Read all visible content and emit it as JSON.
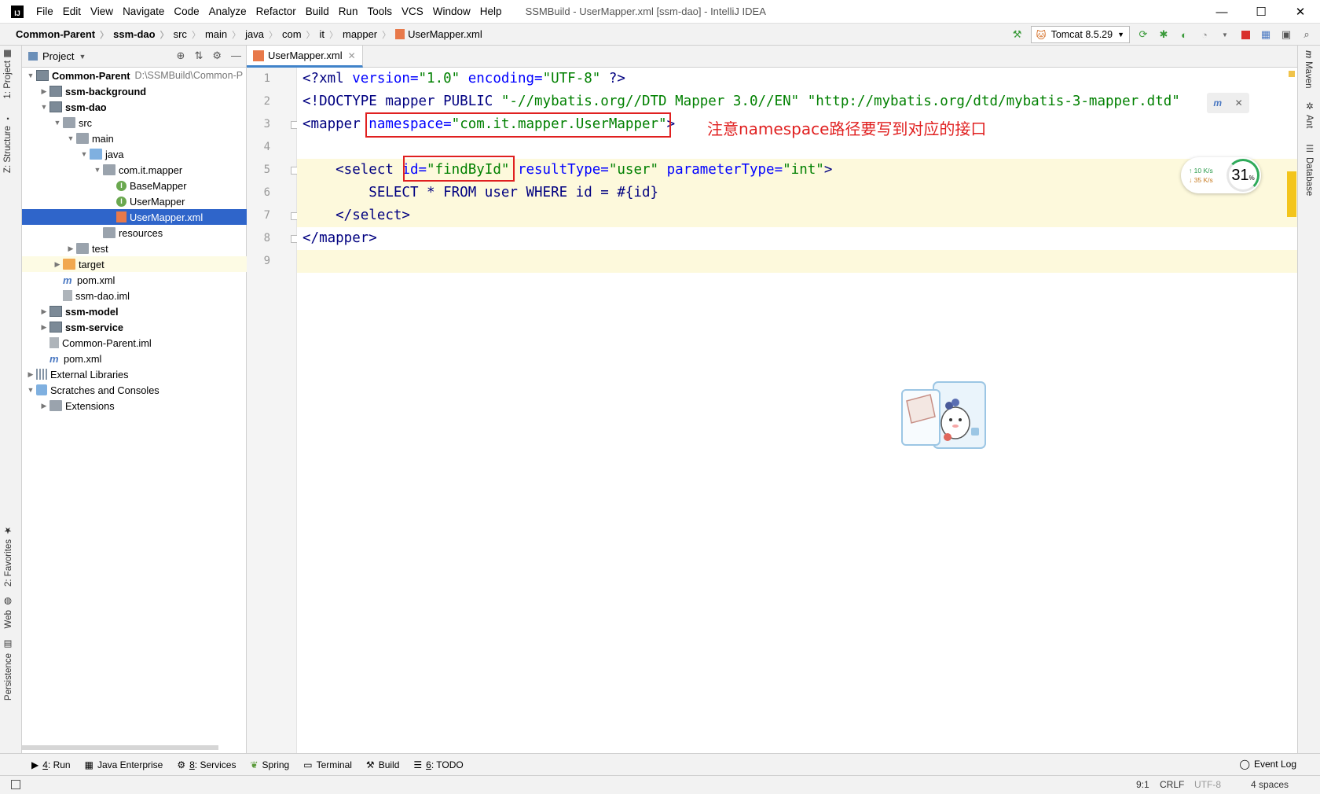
{
  "window": {
    "title": "SSMBuild - UserMapper.xml [ssm-dao] - IntelliJ IDEA",
    "menu": [
      "File",
      "Edit",
      "View",
      "Navigate",
      "Code",
      "Analyze",
      "Refactor",
      "Build",
      "Run",
      "Tools",
      "VCS",
      "Window",
      "Help"
    ],
    "controls": {
      "minimize": "—",
      "maximize": "☐",
      "close": "✕"
    }
  },
  "breadcrumbs": [
    "Common-Parent",
    "ssm-dao",
    "src",
    "main",
    "java",
    "com",
    "it",
    "mapper",
    "UserMapper.xml"
  ],
  "toolbar": {
    "run_config": "Tomcat 8.5.29"
  },
  "left_tool_tabs": [
    "1: Project",
    "Z: Structure",
    "2: Favorites",
    "Web",
    "Persistence"
  ],
  "right_tool_tabs": [
    "Maven",
    "Ant",
    "Database"
  ],
  "project_panel": {
    "title": "Project",
    "tree": [
      {
        "label": "Common-Parent",
        "path": "D:\\SSMBuild\\Common-P",
        "bold": true,
        "depth": 0,
        "arrow": "▼",
        "icon": "module"
      },
      {
        "label": "ssm-background",
        "bold": true,
        "depth": 1,
        "arrow": "▶",
        "icon": "module"
      },
      {
        "label": "ssm-dao",
        "bold": true,
        "depth": 1,
        "arrow": "▼",
        "icon": "module"
      },
      {
        "label": "src",
        "depth": 2,
        "arrow": "▼",
        "icon": "folder"
      },
      {
        "label": "main",
        "depth": 3,
        "arrow": "▼",
        "icon": "folder"
      },
      {
        "label": "java",
        "depth": 4,
        "arrow": "▼",
        "icon": "folder-blue"
      },
      {
        "label": "com.it.mapper",
        "depth": 5,
        "arrow": "▼",
        "icon": "folder"
      },
      {
        "label": "BaseMapper",
        "depth": 6,
        "arrow": "",
        "icon": "interface"
      },
      {
        "label": "UserMapper",
        "depth": 6,
        "arrow": "",
        "icon": "interface"
      },
      {
        "label": "UserMapper.xml",
        "depth": 6,
        "arrow": "",
        "icon": "xml",
        "selected": true
      },
      {
        "label": "resources",
        "depth": 5,
        "arrow": "",
        "icon": "folder"
      },
      {
        "label": "test",
        "depth": 3,
        "arrow": "▶",
        "icon": "folder"
      },
      {
        "label": "target",
        "depth": 2,
        "arrow": "▶",
        "icon": "folder-orange",
        "highlight": true
      },
      {
        "label": "pom.xml",
        "depth": 2,
        "arrow": "",
        "icon": "maven"
      },
      {
        "label": "ssm-dao.iml",
        "depth": 2,
        "arrow": "",
        "icon": "iml"
      },
      {
        "label": "ssm-model",
        "bold": true,
        "depth": 1,
        "arrow": "▶",
        "icon": "module"
      },
      {
        "label": "ssm-service",
        "bold": true,
        "depth": 1,
        "arrow": "▶",
        "icon": "module"
      },
      {
        "label": "Common-Parent.iml",
        "depth": 1,
        "arrow": "",
        "icon": "iml"
      },
      {
        "label": "pom.xml",
        "depth": 1,
        "arrow": "",
        "icon": "maven"
      },
      {
        "label": "External Libraries",
        "depth": 0,
        "arrow": "▶",
        "icon": "library"
      },
      {
        "label": "Scratches and Consoles",
        "depth": 0,
        "arrow": "▼",
        "icon": "scratch"
      },
      {
        "label": "Extensions",
        "depth": 1,
        "arrow": "▶",
        "icon": "folder"
      }
    ]
  },
  "editor": {
    "tab": "UserMapper.xml",
    "line_numbers": [
      "1",
      "2",
      "3",
      "4",
      "5",
      "6",
      "7",
      "8",
      "9"
    ],
    "lines": [
      {
        "t1": "<?xml ",
        "a1": "version=",
        "v1": "\"1.0\" ",
        "a2": "encoding=",
        "v2": "\"UTF-8\"",
        "t2": " ?>"
      },
      {
        "t1": "<!DOCTYPE mapper PUBLIC ",
        "v1": "\"-//mybatis.org//DTD Mapper 3.0//EN\" ",
        "v2": "\"http://mybatis.org/dtd/mybatis-3-mapper.dtd\""
      },
      {
        "t1": "<mapper ",
        "a1": "namespace=",
        "v1": "\"com.it.mapper.UserMapper\"",
        "t2": ">"
      },
      {},
      {
        "t1": "    <select ",
        "a1": "id=",
        "v1": "\"findById\" ",
        "a2": "resultType=",
        "v2": "\"user\" ",
        "a3": "parameterType=",
        "v3": "\"int\"",
        "t2": ">"
      },
      {
        "k": "        SELECT * FROM user WHERE id = #{id}"
      },
      {
        "t1": "    </select>"
      },
      {
        "t1": "</mapper>"
      },
      {}
    ],
    "annotation": "注意namespace路径要写到对应的接口",
    "maven_hint_close": "✕"
  },
  "network_widget": {
    "up": "10 K/s",
    "down": "35 K/s",
    "percent": "31",
    "unit": "%"
  },
  "bottom_tools": [
    {
      "key": "4",
      "label": ": Run"
    },
    {
      "key": "",
      "label": "Java Enterprise"
    },
    {
      "key": "8",
      "label": ": Services"
    },
    {
      "key": "",
      "label": "Spring"
    },
    {
      "key": "",
      "label": "Terminal"
    },
    {
      "key": "",
      "label": "Build"
    },
    {
      "key": "6",
      "label": ": TODO"
    }
  ],
  "event_log": "Event Log",
  "status": {
    "position": "9:1",
    "line_sep": "CRLF",
    "encoding": "UTF-8",
    "indent": "4 spaces"
  },
  "colors": {
    "selection": "#2f65ca",
    "annotation": "#e02020",
    "tag": "#000080",
    "attr": "#0000ff",
    "value": "#008000"
  }
}
